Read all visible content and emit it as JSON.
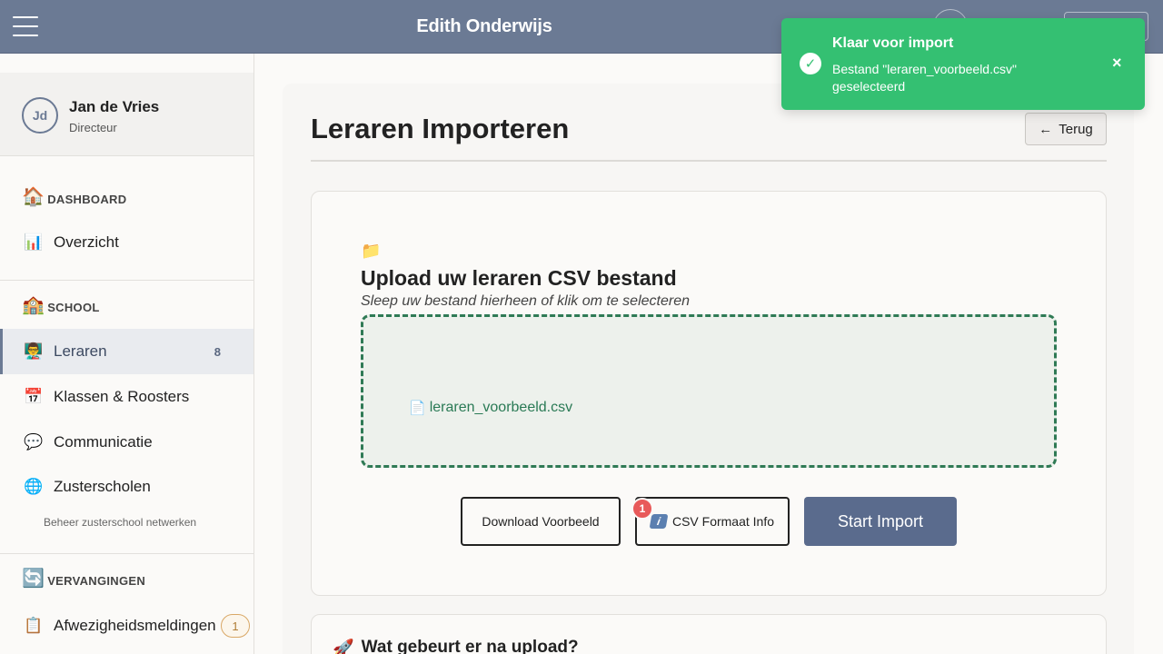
{
  "header": {
    "app_title": "Edith Onderwijs"
  },
  "profile": {
    "initials": "Jd",
    "name": "Jan de Vries",
    "role": "Directeur"
  },
  "sidebar": {
    "sections": [
      {
        "icon": "🏠",
        "label": "DASHBOARD"
      },
      {
        "icon": "🏫",
        "label": "SCHOOL"
      },
      {
        "icon": "🔄",
        "label": "VERVANGINGEN"
      }
    ],
    "items": [
      {
        "icon": "📊",
        "label": "Overzicht"
      },
      {
        "icon": "👨‍🏫",
        "label": "Leraren",
        "count": "8"
      },
      {
        "icon": "📅",
        "label": "Klassen & Roosters"
      },
      {
        "icon": "💬",
        "label": "Communicatie"
      },
      {
        "icon": "🌐",
        "label": "Zusterscholen",
        "sub": "Beheer zusterschool netwerken"
      },
      {
        "icon": "📋",
        "label": "Afwezigheidsmeldingen",
        "badge": "1"
      }
    ]
  },
  "main": {
    "title": "Leraren Importeren",
    "back_label": "Terug",
    "back_icon": "←",
    "upload": {
      "icon": "📁",
      "title": "Upload uw leraren CSV bestand",
      "subtitle": "Sleep uw bestand hierheen of klik om te selecteren",
      "file_icon": "📄",
      "file_name": "leraren_voorbeeld.csv"
    },
    "buttons": {
      "download": "Download Voorbeeld",
      "info": "CSV Formaat Info",
      "info_icon": "i",
      "info_badge": "1",
      "start": "Start Import"
    },
    "next": {
      "icon": "🚀",
      "title": "Wat gebeurt er na upload?"
    }
  },
  "toast": {
    "title": "Klaar voor import",
    "message": "Bestand \"leraren_voorbeeld.csv\" geselecteerd",
    "check_icon": "✓",
    "close_icon": "×",
    "color": "#34c072"
  },
  "colors": {
    "header": "#6b7a94",
    "accent": "#5a6b8d",
    "success": "#34c072",
    "dropzone_border": "#2f7a55"
  }
}
